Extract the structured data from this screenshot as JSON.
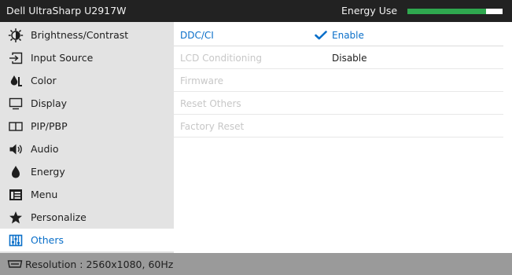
{
  "window": {
    "title": "Dell UltraSharp U2917W",
    "energy_label": "Energy Use",
    "energy_level_percent": 83
  },
  "sidebar": {
    "items": [
      {
        "label": "Brightness/Contrast",
        "icon": "brightness-icon"
      },
      {
        "label": "Input Source",
        "icon": "input-source-icon"
      },
      {
        "label": "Color",
        "icon": "color-icon"
      },
      {
        "label": "Display",
        "icon": "display-icon"
      },
      {
        "label": "PIP/PBP",
        "icon": "pip-pbp-icon"
      },
      {
        "label": "Audio",
        "icon": "audio-icon"
      },
      {
        "label": "Energy",
        "icon": "energy-icon"
      },
      {
        "label": "Menu",
        "icon": "menu-icon"
      },
      {
        "label": "Personalize",
        "icon": "star-icon"
      },
      {
        "label": "Others",
        "icon": "others-icon",
        "active": true
      }
    ]
  },
  "content": {
    "rows": [
      {
        "label": "DDC/CI",
        "value": "Enable",
        "selected": true
      },
      {
        "label": "LCD Conditioning",
        "value": "Disable"
      },
      {
        "label": "Firmware"
      },
      {
        "label": "Reset Others"
      },
      {
        "label": "Factory Reset"
      }
    ]
  },
  "status": {
    "text": "Resolution : 2560x1080, 60Hz",
    "icon": "video-connector-icon"
  },
  "colors": {
    "accent": "#0a6fc9",
    "title_bg": "#222222",
    "sidebar_bg": "#e3e3e3",
    "status_bg": "#9a9a9a",
    "meter_fill": "#2fa84f",
    "disabled_text": "#c7c7c7"
  }
}
